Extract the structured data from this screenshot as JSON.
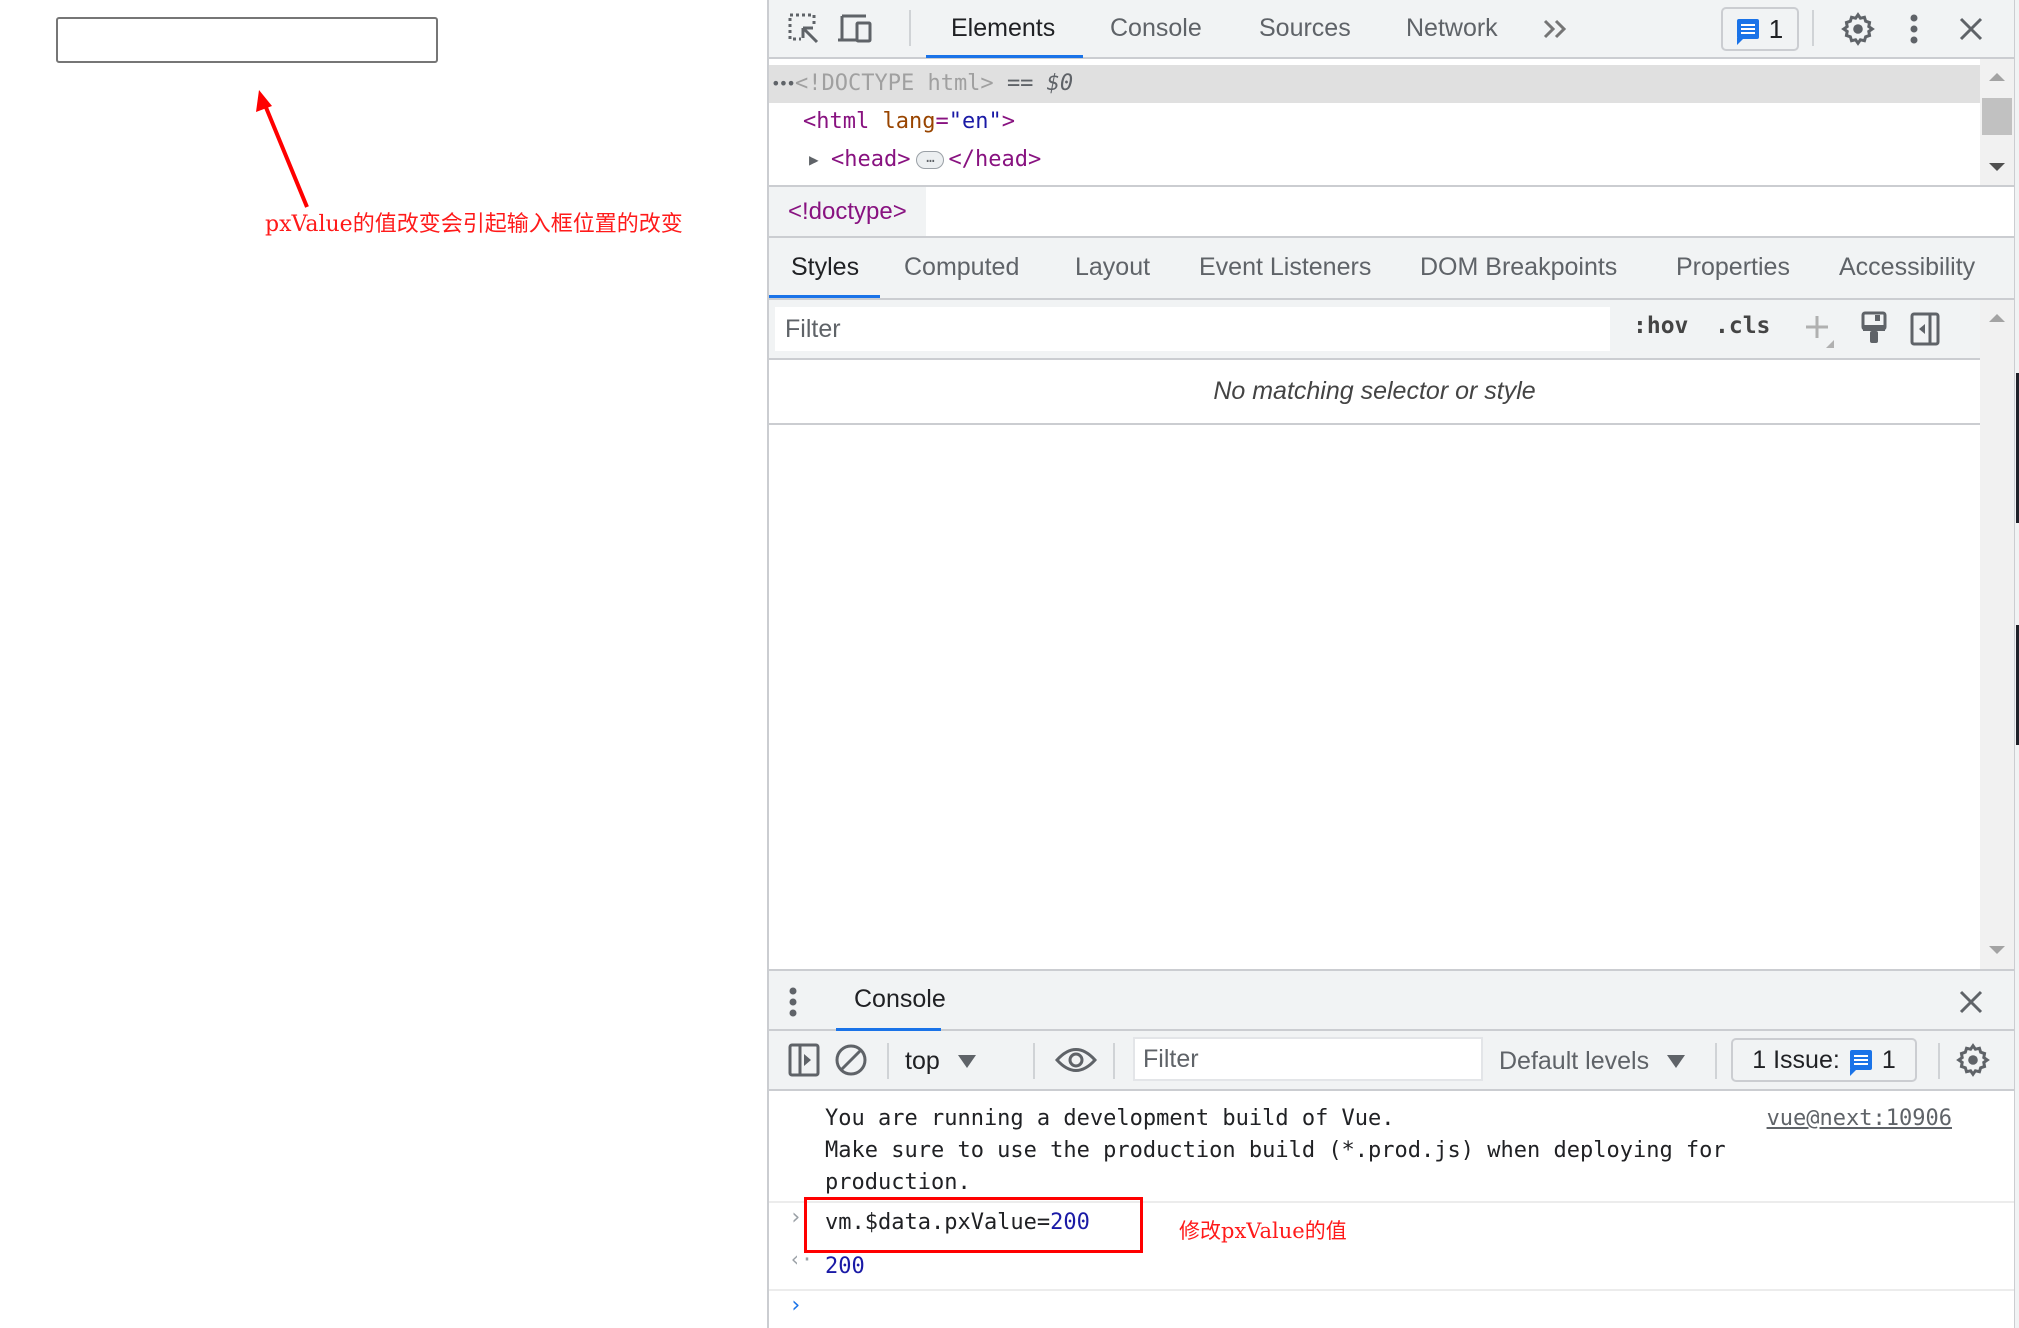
{
  "page": {
    "input_value": "",
    "annotation_top": "pxValue的值改变会引起输入框位置的改变",
    "annotation_color": "#ff1a1a"
  },
  "devtools": {
    "main_tabs": [
      {
        "label": "Elements",
        "active": true
      },
      {
        "label": "Console",
        "active": false
      },
      {
        "label": "Sources",
        "active": false
      },
      {
        "label": "Network",
        "active": false
      }
    ],
    "more_tabs_icon": "chevron-double-right-icon",
    "issues_count": "1",
    "dom_tree": {
      "line1_doctype": "<!DOCTYPE html>",
      "line1_suffix": "== $0",
      "line2_tag_open": "<html ",
      "line2_attr_name": "lang",
      "line2_attr_eq": "=",
      "line2_attr_val": "\"en\"",
      "line2_tag_close": ">",
      "line3_open": "<head>",
      "line3_ellipsis": "…",
      "line3_close": "</head>"
    },
    "breadcrumb": "<!doctype>",
    "styles_tabs": [
      {
        "label": "Styles",
        "active": true
      },
      {
        "label": "Computed",
        "active": false
      },
      {
        "label": "Layout",
        "active": false
      },
      {
        "label": "Event Listeners",
        "active": false
      },
      {
        "label": "DOM Breakpoints",
        "active": false
      },
      {
        "label": "Properties",
        "active": false
      },
      {
        "label": "Accessibility",
        "active": false
      }
    ],
    "styles_filter_placeholder": "Filter",
    "hov_label": ":hov",
    "cls_label": ".cls",
    "no_match_text": "No matching selector or style",
    "accent_color": "#1a73e8"
  },
  "console": {
    "drawer_tab": "Console",
    "context": "top",
    "filter_placeholder": "Filter",
    "levels": "Default levels",
    "issues_label": "1 Issue:",
    "issues_count": "1",
    "messages": {
      "vue_line1": "You are running a development build of Vue.",
      "vue_line2": "Make sure to use the production build (*.prod.js) when deploying for",
      "vue_line3": "production.",
      "vue_source": "vue@next:10906",
      "command_prefix": "vm.$data.pxValue=",
      "command_value": "200",
      "result": "200"
    },
    "annotation": "修改pxValue的值"
  }
}
